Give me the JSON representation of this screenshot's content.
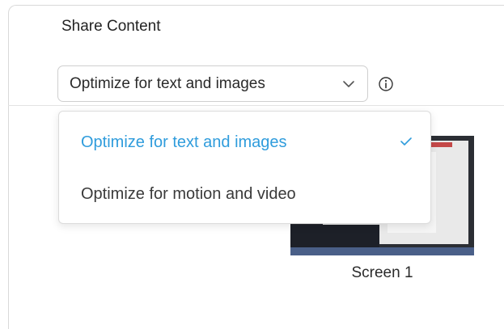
{
  "dialog": {
    "title": "Share Content"
  },
  "quality_select": {
    "selected_value": "Optimize for text and images",
    "options": [
      {
        "label": "Optimize for text and images",
        "selected": true
      },
      {
        "label": "Optimize for motion and video",
        "selected": false
      }
    ]
  },
  "icons": {
    "chevron": "chevron-down-icon",
    "info": "info-icon",
    "check": "checkmark-icon"
  },
  "screens": [
    {
      "label": "Screen 1"
    }
  ],
  "colors": {
    "accent": "#2f9cdc",
    "text": "#2a2a2a",
    "border": "#cfcfcf"
  }
}
